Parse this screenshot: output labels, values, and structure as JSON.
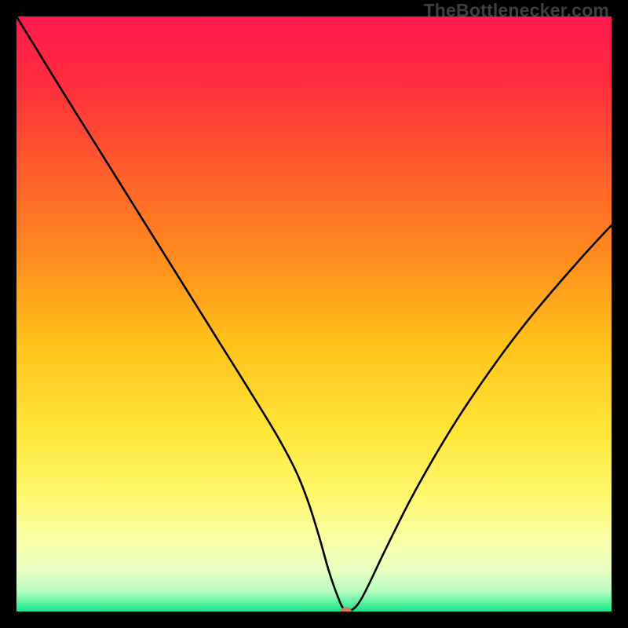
{
  "watermark": "TheBottlenecker.com",
  "colors": {
    "frame": "#000000",
    "curve": "#000000",
    "marker": "#d47b68",
    "gradient_stops": [
      {
        "offset": 0.0,
        "color": "#ff1a4f"
      },
      {
        "offset": 0.1,
        "color": "#ff2a3e"
      },
      {
        "offset": 0.25,
        "color": "#ff5a2c"
      },
      {
        "offset": 0.4,
        "color": "#ff8a1e"
      },
      {
        "offset": 0.55,
        "color": "#ffc21a"
      },
      {
        "offset": 0.7,
        "color": "#ffe63a"
      },
      {
        "offset": 0.8,
        "color": "#fff76a"
      },
      {
        "offset": 0.88,
        "color": "#faffa8"
      },
      {
        "offset": 0.93,
        "color": "#e8ffc0"
      },
      {
        "offset": 0.965,
        "color": "#b8ffc0"
      },
      {
        "offset": 0.985,
        "color": "#5cf2a0"
      },
      {
        "offset": 1.0,
        "color": "#14e28a"
      }
    ]
  },
  "chart_data": {
    "type": "line",
    "title": "",
    "xlabel": "",
    "ylabel": "",
    "xlim": [
      0,
      100
    ],
    "ylim": [
      0,
      100
    ],
    "grid": false,
    "legend": false,
    "series": [
      {
        "name": "bottleneck-curve",
        "x": [
          0,
          4,
          8,
          12,
          16,
          20,
          24,
          28,
          32,
          36,
          40,
          44,
          47,
          49,
          50.8,
          52.5,
          54,
          55,
          56,
          58,
          62,
          66,
          70,
          74,
          78,
          82,
          86,
          90,
          94,
          98,
          100
        ],
        "y": [
          100,
          93.5,
          87,
          80.6,
          74.2,
          67.8,
          61.4,
          55,
          48.6,
          42.2,
          35.8,
          29.2,
          23.5,
          18.5,
          12.8,
          6.8,
          2.5,
          0.4,
          0.1,
          2.2,
          10.4,
          18.4,
          25.6,
          32.2,
          38.2,
          43.8,
          49,
          53.8,
          58.4,
          62.8,
          64.9
        ]
      }
    ],
    "marker": {
      "x": 55.4,
      "y": 0.0,
      "color": "#d47b68",
      "rx": 0.95,
      "ry": 0.72
    }
  }
}
